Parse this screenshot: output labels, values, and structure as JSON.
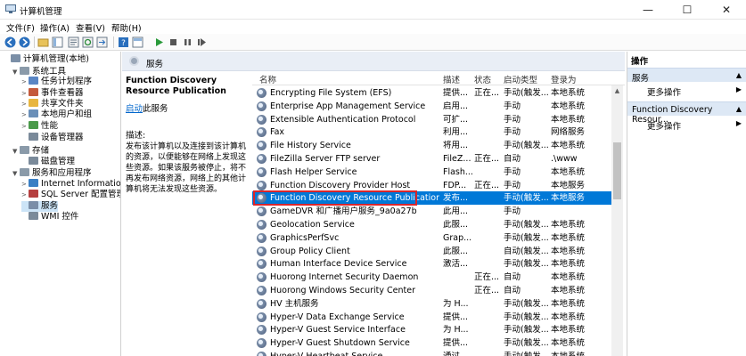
{
  "window": {
    "title": "计算机管理",
    "minimize": "—",
    "maximize": "☐",
    "close": "✕"
  },
  "menubar": [
    "文件(F)",
    "操作(A)",
    "查看(V)",
    "帮助(H)"
  ],
  "tree": [
    {
      "label": "计算机管理(本地)",
      "indent": 0,
      "twisty": "",
      "icon": "#7b8fa7"
    },
    {
      "label": "系统工具",
      "indent": 1,
      "twisty": "▼",
      "icon": "#8a9aa9"
    },
    {
      "label": "任务计划程序",
      "indent": 2,
      "twisty": ">",
      "icon": "#5a86c4"
    },
    {
      "label": "事件查看器",
      "indent": 2,
      "twisty": ">",
      "icon": "#c45a3c"
    },
    {
      "label": "共享文件夹",
      "indent": 2,
      "twisty": ">",
      "icon": "#e8b640"
    },
    {
      "label": "本地用户和组",
      "indent": 2,
      "twisty": ">",
      "icon": "#6a8fb8"
    },
    {
      "label": "性能",
      "indent": 2,
      "twisty": ">",
      "icon": "#4a9a4a"
    },
    {
      "label": "设备管理器",
      "indent": 2,
      "twisty": "",
      "icon": "#7a8a9a"
    },
    {
      "label": "存储",
      "indent": 1,
      "twisty": "▼",
      "icon": "#8a9aa9"
    },
    {
      "label": "磁盘管理",
      "indent": 2,
      "twisty": "",
      "icon": "#7a8a9a"
    },
    {
      "label": "服务和应用程序",
      "indent": 1,
      "twisty": "▼",
      "icon": "#8a9aa9"
    },
    {
      "label": "Internet Information Se",
      "indent": 2,
      "twisty": ">",
      "icon": "#3a7fc4"
    },
    {
      "label": "SQL Server 配置管理器",
      "indent": 2,
      "twisty": ">",
      "icon": "#b64040"
    },
    {
      "label": "服务",
      "indent": 2,
      "twisty": "",
      "icon": "#7b8ea8",
      "selected": true
    },
    {
      "label": "WMI 控件",
      "indent": 2,
      "twisty": "",
      "icon": "#7a8a9a"
    }
  ],
  "center": {
    "header": "服务",
    "desc_title": "Function Discovery Resource Publication",
    "start_link": "启动",
    "start_suffix": "此服务",
    "desc_label": "描述:",
    "desc_text": "发布该计算机以及连接到该计算机的资源，以便能够在网络上发现这些资源。如果该服务被停止，将不再发布网络资源，网络上的其他计算机将无法发现这些资源。"
  },
  "columns": [
    "名称",
    "描述",
    "状态",
    "启动类型",
    "登录为"
  ],
  "services": [
    {
      "name": "Encrypting File System (EFS)",
      "desc": "提供...",
      "status": "正在...",
      "startup": "手动(触发...",
      "logon": "本地系统"
    },
    {
      "name": "Enterprise App Management Service",
      "desc": "启用...",
      "status": "",
      "startup": "手动",
      "logon": "本地系统"
    },
    {
      "name": "Extensible Authentication Protocol",
      "desc": "可扩...",
      "status": "",
      "startup": "手动",
      "logon": "本地系统"
    },
    {
      "name": "Fax",
      "desc": "利用...",
      "status": "",
      "startup": "手动",
      "logon": "网络服务"
    },
    {
      "name": "File History Service",
      "desc": "将用...",
      "status": "",
      "startup": "手动(触发...",
      "logon": "本地系统"
    },
    {
      "name": "FileZilla Server FTP server",
      "desc": "FileZ...",
      "status": "正在...",
      "startup": "自动",
      "logon": ".\\www"
    },
    {
      "name": "Flash Helper Service",
      "desc": "Flash...",
      "status": "",
      "startup": "手动",
      "logon": "本地系统"
    },
    {
      "name": "Function Discovery Provider Host",
      "desc": "FDP...",
      "status": "正在...",
      "startup": "手动",
      "logon": "本地服务"
    },
    {
      "name": "Function Discovery Resource Publication",
      "desc": "发布...",
      "status": "",
      "startup": "手动(触发...",
      "logon": "本地服务",
      "selected": true
    },
    {
      "name": "GameDVR 和广播用户服务_9a0a27b",
      "desc": "此用...",
      "status": "",
      "startup": "手动",
      "logon": ""
    },
    {
      "name": "Geolocation Service",
      "desc": "此服...",
      "status": "",
      "startup": "手动(触发...",
      "logon": "本地系统"
    },
    {
      "name": "GraphicsPerfSvc",
      "desc": "Grap...",
      "status": "",
      "startup": "手动(触发...",
      "logon": "本地系统"
    },
    {
      "name": "Group Policy Client",
      "desc": "此服...",
      "status": "",
      "startup": "自动(触发...",
      "logon": "本地系统"
    },
    {
      "name": "Human Interface Device Service",
      "desc": "激活...",
      "status": "",
      "startup": "手动(触发...",
      "logon": "本地系统"
    },
    {
      "name": "Huorong Internet Security Daemon",
      "desc": "",
      "status": "正在...",
      "startup": "自动",
      "logon": "本地系统"
    },
    {
      "name": "Huorong Windows Security Center",
      "desc": "",
      "status": "正在...",
      "startup": "自动",
      "logon": "本地系统"
    },
    {
      "name": "HV 主机服务",
      "desc": "为 H...",
      "status": "",
      "startup": "手动(触发...",
      "logon": "本地系统"
    },
    {
      "name": "Hyper-V Data Exchange Service",
      "desc": "提供...",
      "status": "",
      "startup": "手动(触发...",
      "logon": "本地系统"
    },
    {
      "name": "Hyper-V Guest Service Interface",
      "desc": "为 H...",
      "status": "",
      "startup": "手动(触发...",
      "logon": "本地系统"
    },
    {
      "name": "Hyper-V Guest Shutdown Service",
      "desc": "提供...",
      "status": "",
      "startup": "手动(触发...",
      "logon": "本地系统"
    },
    {
      "name": "Hyper-V Heartbeat Service",
      "desc": "通过...",
      "status": "",
      "startup": "手动(触发...",
      "logon": "本地系统"
    }
  ],
  "actions": {
    "title": "操作",
    "section1": "服务",
    "more1": "更多操作",
    "section2": "Function Discovery Resour...",
    "more2": "更多操作",
    "up_arrow": "▲",
    "right_arrow": "▶"
  }
}
